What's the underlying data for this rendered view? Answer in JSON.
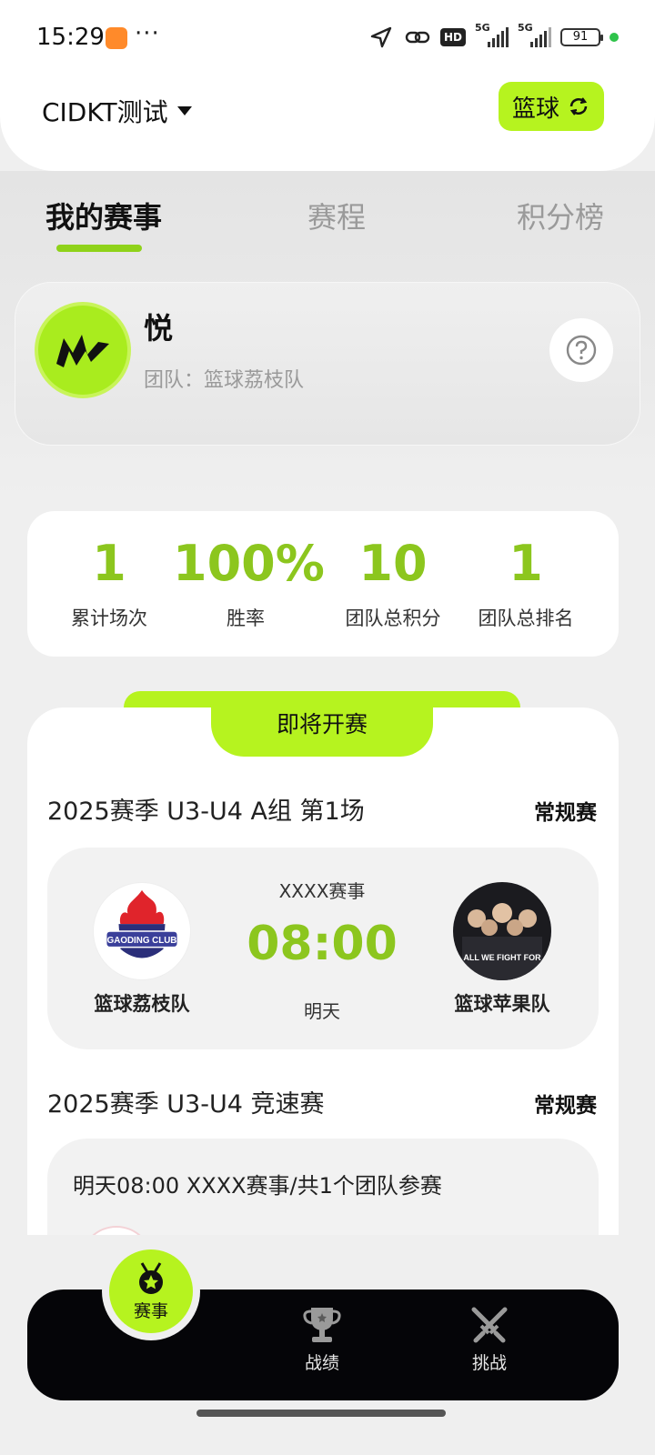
{
  "status_bar": {
    "time": "15:29",
    "dots": "···",
    "network_1": "5G",
    "network_2": "5G",
    "hd_label": "HD",
    "battery": "91"
  },
  "header": {
    "org_name": "CIDKT测试",
    "sport_label": "篮球"
  },
  "tabs": [
    {
      "label": "我的赛事",
      "active": true
    },
    {
      "label": "赛程",
      "active": false
    },
    {
      "label": "积分榜",
      "active": false
    }
  ],
  "profile": {
    "name": "悦",
    "team_prefix": "团队：",
    "team_name": "篮球荔枝队"
  },
  "stats": [
    {
      "value": "1",
      "label": "累计场次"
    },
    {
      "value": "100%",
      "label": "胜率"
    },
    {
      "value": "10",
      "label": "团队总积分"
    },
    {
      "value": "1",
      "label": "团队总排名"
    }
  ],
  "upcoming": {
    "section_label": "即将开赛",
    "matches": [
      {
        "title": "2025赛季 U3-U4 A组 第1场",
        "type": "常规赛",
        "event": "XXXX赛事",
        "time": "08:00",
        "day": "明天",
        "home_team": "篮球荔枝队",
        "away_team": "篮球苹果队",
        "home_logo_text": "GAODING CLUB",
        "away_logo_text": "ALL WE FIGHT FOR"
      },
      {
        "title": "2025赛季 U3-U4 竞速赛",
        "type": "常规赛",
        "info": "明天08:00 XXXX赛事/共1个团队参赛"
      }
    ]
  },
  "bottom_nav": [
    {
      "label": "赛事",
      "icon": "medal-icon",
      "active": true
    },
    {
      "label": "战绩",
      "icon": "trophy-icon",
      "active": false
    },
    {
      "label": "挑战",
      "icon": "crossed-swords-icon",
      "active": false
    }
  ],
  "colors": {
    "accent": "#b6f31f",
    "accent_text": "#8cc61e",
    "nav_bg": "#050508",
    "page_bg": "#efefef"
  }
}
